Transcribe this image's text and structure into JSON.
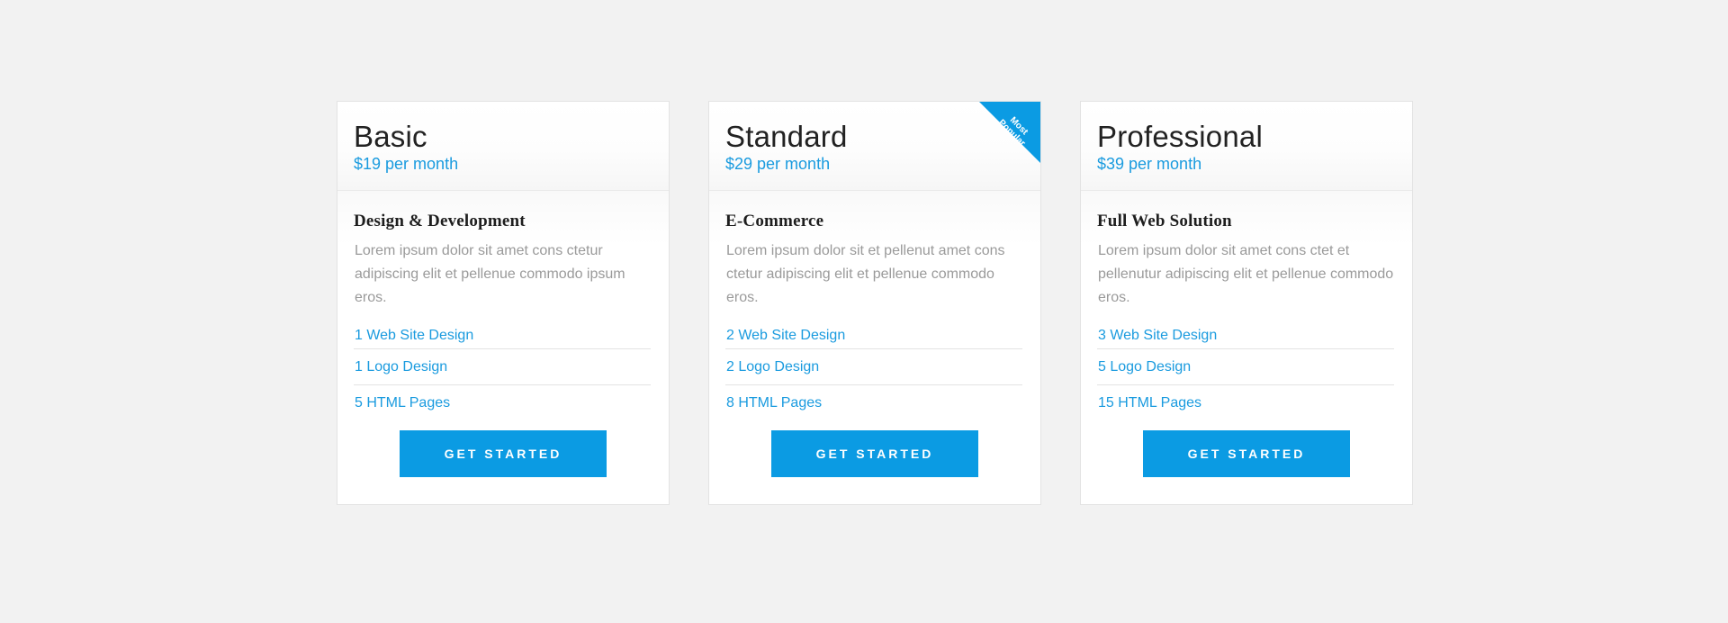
{
  "plans": [
    {
      "name": "Basic",
      "price": "$19 per month",
      "title": "Design & Development",
      "description": "Lorem ipsum dolor sit amet cons ctetur adipiscing elit et pellenue commodo ipsum eros.",
      "features": [
        "1 Web Site Design",
        "1 Logo Design",
        "5 HTML Pages"
      ],
      "button": "GET STARTED"
    },
    {
      "name": "Standard",
      "price": "$29 per month",
      "title": "E-Commerce",
      "description": "Lorem ipsum dolor sit et pellenut amet cons ctetur adipiscing elit et pellenue commodo eros.",
      "features": [
        "2 Web Site Design",
        "2 Logo Design",
        "8 HTML Pages"
      ],
      "button": "GET STARTED",
      "badge": [
        "Most",
        "Popular"
      ]
    },
    {
      "name": "Professional",
      "price": "$39 per month",
      "title": "Full Web Solution",
      "description": "Lorem ipsum dolor sit amet cons ctet et pellenutur adipiscing elit et pellenue commodo eros.",
      "features": [
        "3 Web Site Design",
        "5 Logo Design",
        "15 HTML Pages"
      ],
      "button": "GET STARTED"
    }
  ],
  "colors": {
    "accent": "#0b9be3",
    "background": "#f2f2f2",
    "text_muted": "#9a9a9a"
  }
}
